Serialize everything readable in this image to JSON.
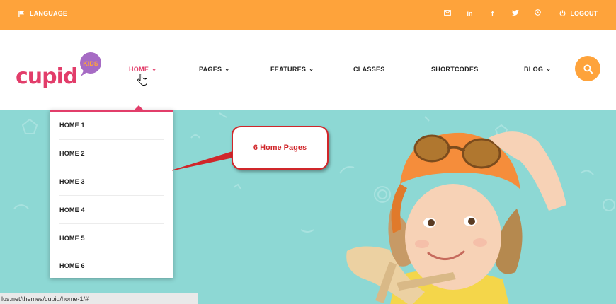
{
  "topbar": {
    "language_label": "LANGUAGE",
    "socials": [
      "envelope-icon",
      "linkedin-icon",
      "facebook-icon",
      "twitter-icon",
      "dribbble-icon"
    ],
    "logout_label": "LOGOUT"
  },
  "logo": {
    "text": "cupid",
    "badge": "KIDS"
  },
  "nav": {
    "items": [
      {
        "label": "HOME",
        "dropdown": true,
        "active": true
      },
      {
        "label": "PAGES",
        "dropdown": true
      },
      {
        "label": "FEATURES",
        "dropdown": true
      },
      {
        "label": "CLASSES",
        "dropdown": false
      },
      {
        "label": "SHORTCODES",
        "dropdown": false
      },
      {
        "label": "BLOG",
        "dropdown": true
      }
    ]
  },
  "dropdown": {
    "items": [
      "HOME 1",
      "HOME 2",
      "HOME 3",
      "HOME 4",
      "HOME 5",
      "HOME 6"
    ]
  },
  "callout": {
    "text": "6 Home Pages"
  },
  "statusbar": {
    "url": "lus.net/themes/cupid/home-1/#"
  },
  "colors": {
    "orange": "#fea33b",
    "pink": "#e23d6a",
    "teal": "#8dd8d4",
    "purple": "#a66bc4",
    "callout_red": "#d0262a"
  }
}
